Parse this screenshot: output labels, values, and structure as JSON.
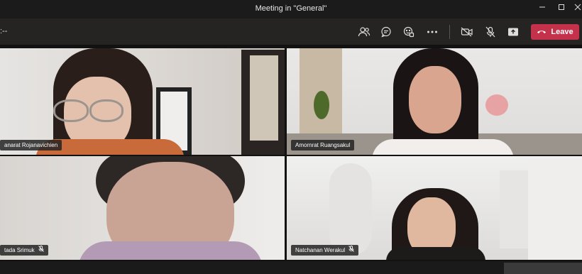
{
  "window": {
    "title": "Meeting in \"General\""
  },
  "toolbar": {
    "elapsed": ":--",
    "leave_label": "Leave"
  },
  "participants": [
    {
      "name": "anarat Rojanavichien",
      "muted": false
    },
    {
      "name": "Amornrat Ruangsakul",
      "muted": false
    },
    {
      "name": "tada Srimuk",
      "muted": true
    },
    {
      "name": "Natchanan Werakul",
      "muted": true
    }
  ],
  "colors": {
    "leave": "#c4314b",
    "toolbar": "#252423",
    "titlebar": "#1b1b1b"
  },
  "icons": [
    "participants-icon",
    "chat-icon",
    "reactions-icon",
    "more-options-icon",
    "camera-off-icon",
    "mic-off-icon",
    "share-screen-icon",
    "phone-hangup-icon",
    "minimize-icon",
    "maximize-icon",
    "close-icon",
    "mic-muted-icon"
  ]
}
